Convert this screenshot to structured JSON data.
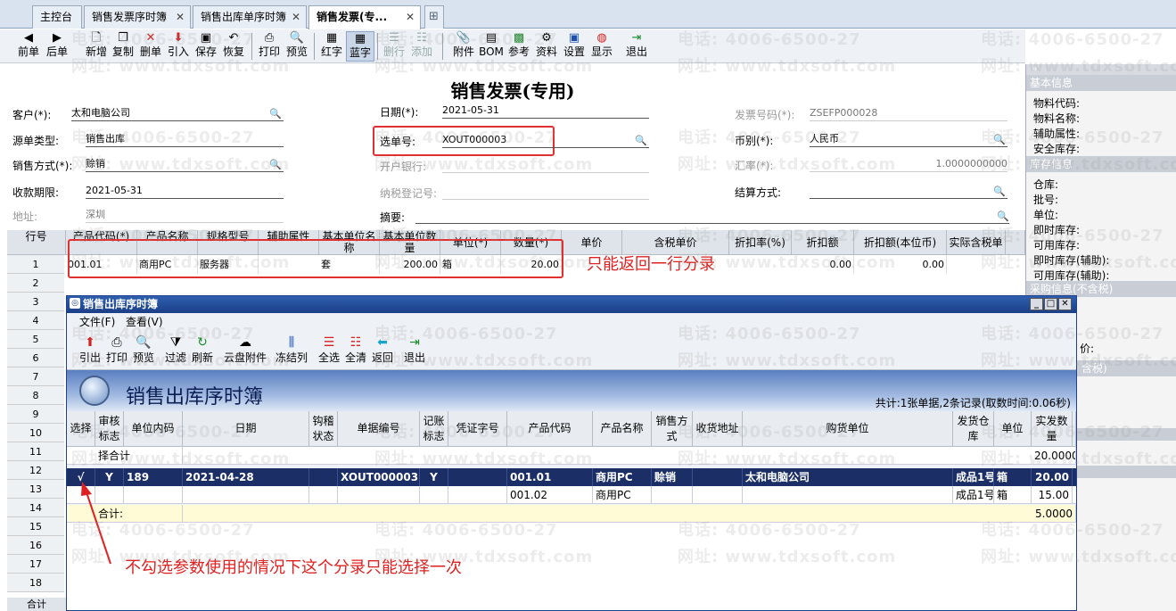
{
  "tabs": [
    {
      "label": "主控台",
      "closable": false
    },
    {
      "label": "销售发票序时簿",
      "closable": true
    },
    {
      "label": "销售出库单序时簿",
      "closable": true
    },
    {
      "label": "销售发票(专...",
      "closable": true,
      "active": true
    }
  ],
  "toolbar": [
    {
      "label": "前单",
      "icon": "arrow-left-icon"
    },
    {
      "label": "后单",
      "icon": "arrow-right-icon"
    },
    {
      "label": "新增",
      "icon": "new-doc-icon"
    },
    {
      "label": "复制",
      "icon": "copy-icon"
    },
    {
      "label": "删单",
      "icon": "delete-x-icon"
    },
    {
      "label": "引入",
      "icon": "import-icon"
    },
    {
      "label": "保存",
      "icon": "save-disk-icon"
    },
    {
      "label": "恢复",
      "icon": "restore-icon"
    },
    {
      "label": "打印",
      "icon": "printer-icon"
    },
    {
      "label": "预览",
      "icon": "preview-icon"
    },
    {
      "label": "红字",
      "icon": "red-grid-icon"
    },
    {
      "label": "蓝字",
      "icon": "blue-grid-icon"
    },
    {
      "label": "删行",
      "icon": "delete-row-icon",
      "disabled": true
    },
    {
      "label": "添加",
      "icon": "add-row-icon",
      "disabled": true
    },
    {
      "label": "附件",
      "icon": "attachment-icon"
    },
    {
      "label": "BOM",
      "icon": "bom-icon"
    },
    {
      "label": "参考",
      "icon": "reference-icon"
    },
    {
      "label": "资料",
      "icon": "info-icon"
    },
    {
      "label": "设置",
      "icon": "settings-icon"
    },
    {
      "label": "显示",
      "icon": "display-icon"
    },
    {
      "label": "退出",
      "icon": "exit-icon"
    }
  ],
  "form": {
    "title": "销售发票(专用)",
    "customer_label": "客户(*):",
    "customer": "太和电脑公司",
    "source_type_label": "源单类型:",
    "source_type": "销售出库",
    "sale_method_label": "销售方式(*):",
    "sale_method": "赊销",
    "due_date_label": "收款期限:",
    "due_date": "2021-05-31",
    "address_label": "地址:",
    "address": "深圳",
    "date_label": "日期(*):",
    "date": "2021-05-31",
    "select_no_label": "选单号:",
    "select_no": "XOUT000003",
    "bank_label": "开户银行:",
    "bank": "",
    "tax_reg_label": "纳税登记号:",
    "tax_reg": "",
    "summary_label": "摘要:",
    "summary": "",
    "invoice_no_label": "发票号码(*):",
    "invoice_no": "ZSEFP000028",
    "currency_label": "币别(*):",
    "currency": "人民币",
    "rate_label": "汇率(*):",
    "rate": "1.0000000000",
    "settle_label": "结算方式:",
    "settle": ""
  },
  "grid": {
    "headers": [
      "行号",
      "产品代码(*)",
      "产品名称",
      "规格型号",
      "辅助属性",
      "基本单位名称",
      "基本单位数量",
      "单位(*)",
      "数量(*)",
      "单价",
      "含税单价",
      "折扣率(%)",
      "折扣额",
      "折扣额(本位币)",
      "实际含税单价"
    ],
    "row_numbers": [
      "1",
      "2",
      "3",
      "4",
      "5",
      "6",
      "7",
      "8",
      "9",
      "10",
      "11",
      "12",
      "13",
      "14",
      "15",
      "16",
      "17",
      "18"
    ],
    "total_label": "合计",
    "row1": {
      "code": "001.01",
      "name": "商用PC",
      "spec": "服务器",
      "unit_name": "套",
      "base_qty": "200.00",
      "unit": "箱",
      "qty": "20.00",
      "discount": "0.00",
      "discount_local": "0.00"
    }
  },
  "annotation_top": "只能返回一行分录",
  "annotation_bottom": "不勾选参数使用的情况下这个分录只能选择一次",
  "right_panel": {
    "sections": [
      {
        "title": "基本信息",
        "items": [
          "物料代码:",
          "物料名称:",
          "辅助属性:",
          "安全库存:"
        ]
      },
      {
        "title": "库存信息",
        "items": [
          "仓库:",
          "批号:",
          "单位:",
          "即时库存:",
          "可用库存:",
          "即时库存(辅助):",
          "可用库存(辅助):"
        ]
      },
      {
        "title": "采购信息(不含税)",
        "items": []
      },
      {
        "title": "价:",
        "items": []
      },
      {
        "title": "含税)",
        "items": []
      }
    ]
  },
  "popup": {
    "title": "销售出库序时簿",
    "menu": [
      "文件(F)",
      "查看(V)"
    ],
    "toolbar": [
      {
        "label": "引出",
        "icon": "export-icon"
      },
      {
        "label": "打印",
        "icon": "printer-icon"
      },
      {
        "label": "预览",
        "icon": "preview-icon"
      },
      {
        "label": "过滤",
        "icon": "filter-icon"
      },
      {
        "label": "刷新",
        "icon": "refresh-icon"
      },
      {
        "label": "云盘附件",
        "icon": "cloud-attachment-icon"
      },
      {
        "label": "冻结列",
        "icon": "freeze-column-icon"
      },
      {
        "label": "全选",
        "icon": "select-all-icon"
      },
      {
        "label": "全清",
        "icon": "clear-all-icon"
      },
      {
        "label": "返回",
        "icon": "return-arrow-icon"
      },
      {
        "label": "退出",
        "icon": "exit-icon"
      }
    ],
    "banner_title": "销售出库序时簿",
    "count_text": "共计:1张单据,2条记录(取数时间:0.06秒)",
    "headers": [
      "选择",
      "审核标志",
      "单位内码",
      "日期",
      "钩稽状态",
      "单据编号",
      "记账标志",
      "凭证字号",
      "产品代码",
      "产品名称",
      "销售方式",
      "收货地址",
      "购货单位",
      "发货仓库",
      "单位",
      "实发数量"
    ],
    "filter_row": {
      "label": "择合计",
      "qty": "20.0000"
    },
    "rows": [
      {
        "select": "√",
        "audit": "Y",
        "unit_id": "189",
        "date": "2021-04-28",
        "hook": "",
        "bill_no": "XOUT000003",
        "posted": "Y",
        "voucher": "",
        "code": "001.01",
        "name": "商用PC",
        "method": "赊销",
        "address": "",
        "buyer": "太和电脑公司",
        "warehouse": "成品1号",
        "unit": "箱",
        "qty": "20.00"
      },
      {
        "select": "",
        "audit": "",
        "unit_id": "",
        "date": "",
        "hook": "",
        "bill_no": "",
        "posted": "",
        "voucher": "",
        "code": "001.02",
        "name": "商用PC",
        "method": "",
        "address": "",
        "buyer": "",
        "warehouse": "成品1号",
        "unit": "箱",
        "qty": "15.00"
      }
    ],
    "total_label": "合计:",
    "total_qty": "5.0000"
  },
  "watermark": {
    "phone": "电话: 4006-6500-27",
    "site": "网址: www.tdxsoft.com"
  },
  "colors": {
    "accent": "#1b2f66",
    "annotation": "#e02020",
    "selected_row": "#1b2f66",
    "total_row": "#fffbd6"
  }
}
